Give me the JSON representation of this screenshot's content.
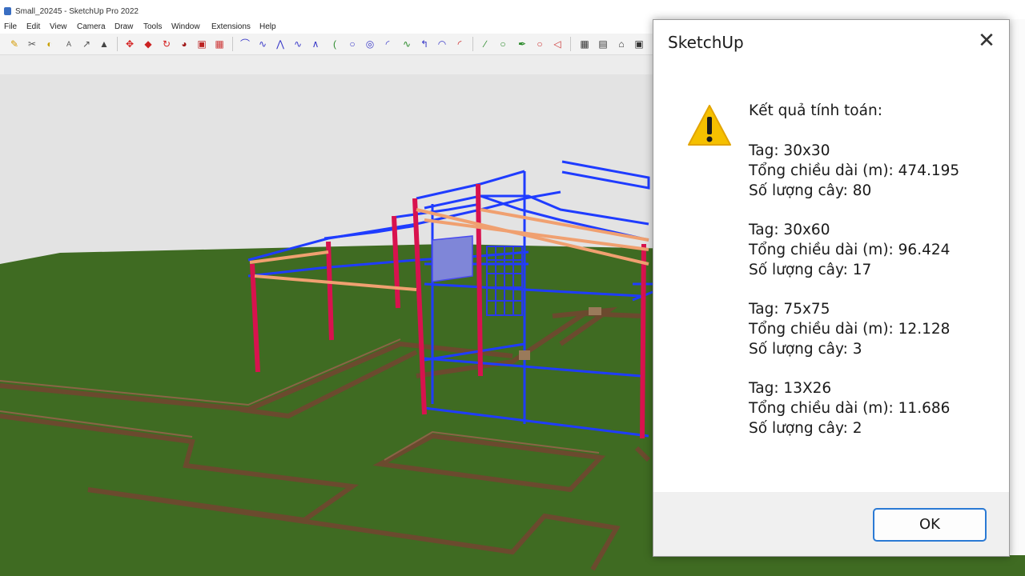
{
  "window": {
    "title": "Small_20245 - SketchUp Pro 2022"
  },
  "menu": [
    "File",
    "Edit",
    "View",
    "Camera",
    "Draw",
    "Tools",
    "Window",
    "Extensions",
    "Help"
  ],
  "toolbar_icons": [
    "pencil-icon",
    "scissors-icon",
    "paint-icon",
    "text-icon",
    "dimension-icon",
    "push-icon",
    "move-icon",
    "orbit-icon",
    "rotate-icon",
    "follow-me-icon",
    "scale-icon",
    "offset-icon",
    "line-icon",
    "freehand-icon",
    "arc-icon",
    "spline-icon",
    "circle-icon",
    "rectangle-icon",
    "polygon-icon",
    "pie-icon",
    "curve-icon",
    "3d-line-icon",
    "polyline-icon",
    "bezier-icon",
    "pan-icon",
    "zoom-icon",
    "home-icon",
    "warehouse-icon",
    "component-icon",
    "section-icon"
  ],
  "dialog": {
    "title": "SketchUp",
    "close_glyph": "✕",
    "heading": "Kết quả tính toán:",
    "results": [
      {
        "tag": "Tag: 30x30",
        "length": "Tổng chiều dài (m): 474.195",
        "count": "Số lượng cây: 80"
      },
      {
        "tag": "Tag: 30x60",
        "length": "Tổng chiều dài (m): 96.424",
        "count": "Số lượng cây: 17"
      },
      {
        "tag": "Tag: 75x75",
        "length": "Tổng chiều dài (m): 12.128",
        "count": "Số lượng cây: 3"
      },
      {
        "tag": "Tag: 13X26",
        "length": "Tổng chiều dài (m): 11.686",
        "count": "Số lượng cây: 2"
      }
    ],
    "ok_label": "OK",
    "icon": "warning-icon"
  },
  "colors": {
    "ground": "#3f6b22",
    "sky": "#e3e3e3",
    "steel_blue": "#1f3cff",
    "steel_red": "#d8124e",
    "steel_orange": "#f0a070",
    "trench": "#6b4a2e",
    "accent": "#2b7ad4",
    "warning": "#f5c000"
  }
}
